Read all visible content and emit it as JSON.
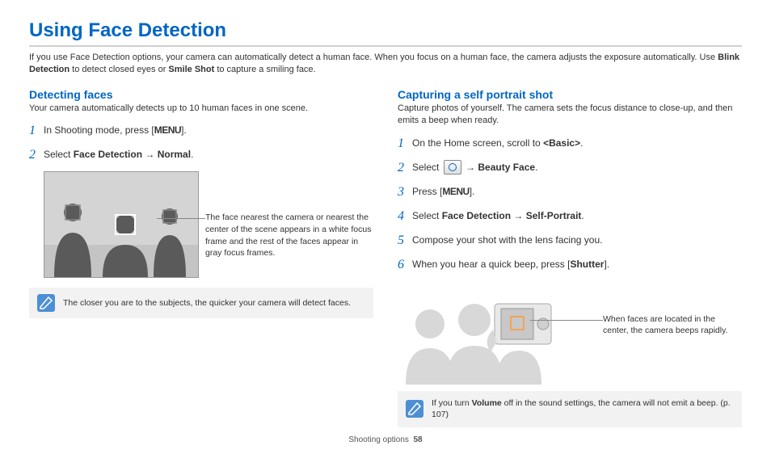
{
  "page_title": "Using Face Detection",
  "intro_a": "If you use Face Detection options, your camera can automatically detect a human face. When you focus on a human face, the camera adjusts the exposure automatically. Use ",
  "intro_b1": "Blink Detection",
  "intro_c": " to detect closed eyes or ",
  "intro_b2": "Smile Shot",
  "intro_d": " to capture a smiling face.",
  "left": {
    "heading": "Detecting faces",
    "sub": "Your camera automatically detects up to 10 human faces in one scene.",
    "step1_a": "In Shooting mode, press [",
    "step1_menu": "MENU",
    "step1_b": "].",
    "step2_a": "Select ",
    "step2_b": "Face Detection",
    "step2_arrow": " → ",
    "step2_c": "Normal",
    "step2_d": ".",
    "caption": "The face nearest the camera or nearest the center of the scene appears in a white focus frame and the rest of the faces appear in gray focus frames.",
    "note": "The closer you are to the subjects, the quicker your camera will detect faces."
  },
  "right": {
    "heading": "Capturing a self portrait shot",
    "sub": "Capture photos of yourself. The camera sets the focus distance to close-up, and then emits a beep when ready.",
    "s1_a": "On the Home screen, scroll to ",
    "s1_b": "<Basic>",
    "s1_c": ".",
    "s2_a": "Select ",
    "s2_arrow": " → ",
    "s2_b": "Beauty Face",
    "s2_c": ".",
    "s3_a": "Press [",
    "s3_menu": "MENU",
    "s3_b": "].",
    "s4_a": "Select ",
    "s4_b": "Face Detection",
    "s4_arrow": " → ",
    "s4_c": "Self-Portrait",
    "s4_d": ".",
    "s5": "Compose your shot with the lens facing you.",
    "s6_a": "When you hear a quick beep, press [",
    "s6_b": "Shutter",
    "s6_c": "].",
    "caption": "When faces are located in the center, the camera beeps rapidly.",
    "note_a": "If you turn ",
    "note_b": "Volume",
    "note_c": " off in the sound settings, the camera will not emit a beep. (p. 107)"
  },
  "footer_label": "Shooting options",
  "footer_page": "58"
}
